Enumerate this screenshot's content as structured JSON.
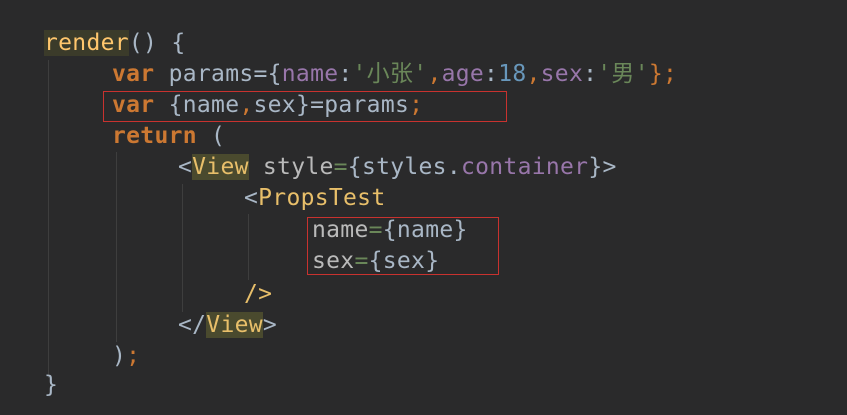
{
  "lines": {
    "l1": {
      "render": "render",
      "paren": "() {"
    },
    "l2": {
      "var": "var",
      "params": " params={",
      "name_key": "name",
      "colon1": ":",
      "name_val": "'小张'",
      "comma1": ",",
      "age_key": "age",
      "colon2": ":",
      "age_val": "18",
      "comma2": ",",
      "sex_key": "sex",
      "colon3": ":",
      "sex_val": "'男'",
      "end": "};"
    },
    "l3": {
      "var": "var",
      "rest": " {name",
      "comma": ",",
      "rest2": "sex}=params",
      "semi": ";"
    },
    "l4": {
      "return": "return",
      "rest": " ("
    },
    "l5": {
      "lt": "<",
      "tag": "View",
      "attr": " style",
      "eq": "=",
      "rest": "{styles.",
      "prop": "container",
      "end": "}>"
    },
    "l6": {
      "lt": "<",
      "tag": "PropsTest"
    },
    "l7": {
      "attr": "name",
      "eq": "=",
      "rest": "{name}"
    },
    "l8": {
      "attr": "sex",
      "eq": "=",
      "rest": "{sex}"
    },
    "l9": {
      "tag": "/>"
    },
    "l10": {
      "lt": "</",
      "tag": "View",
      "end": ">"
    },
    "l11": {
      "rest": ")",
      "semi": ";"
    },
    "l12": {
      "rest": "}"
    }
  },
  "colors": {
    "background": "#2a2a2b",
    "keyword": "#cc7832",
    "function": "#ffc66d",
    "property": "#9876aa",
    "string": "#6a8759",
    "number": "#6897bb",
    "tag": "#e8bf6a",
    "text": "#a9b7c6",
    "highlight_box": "#c8322f"
  }
}
